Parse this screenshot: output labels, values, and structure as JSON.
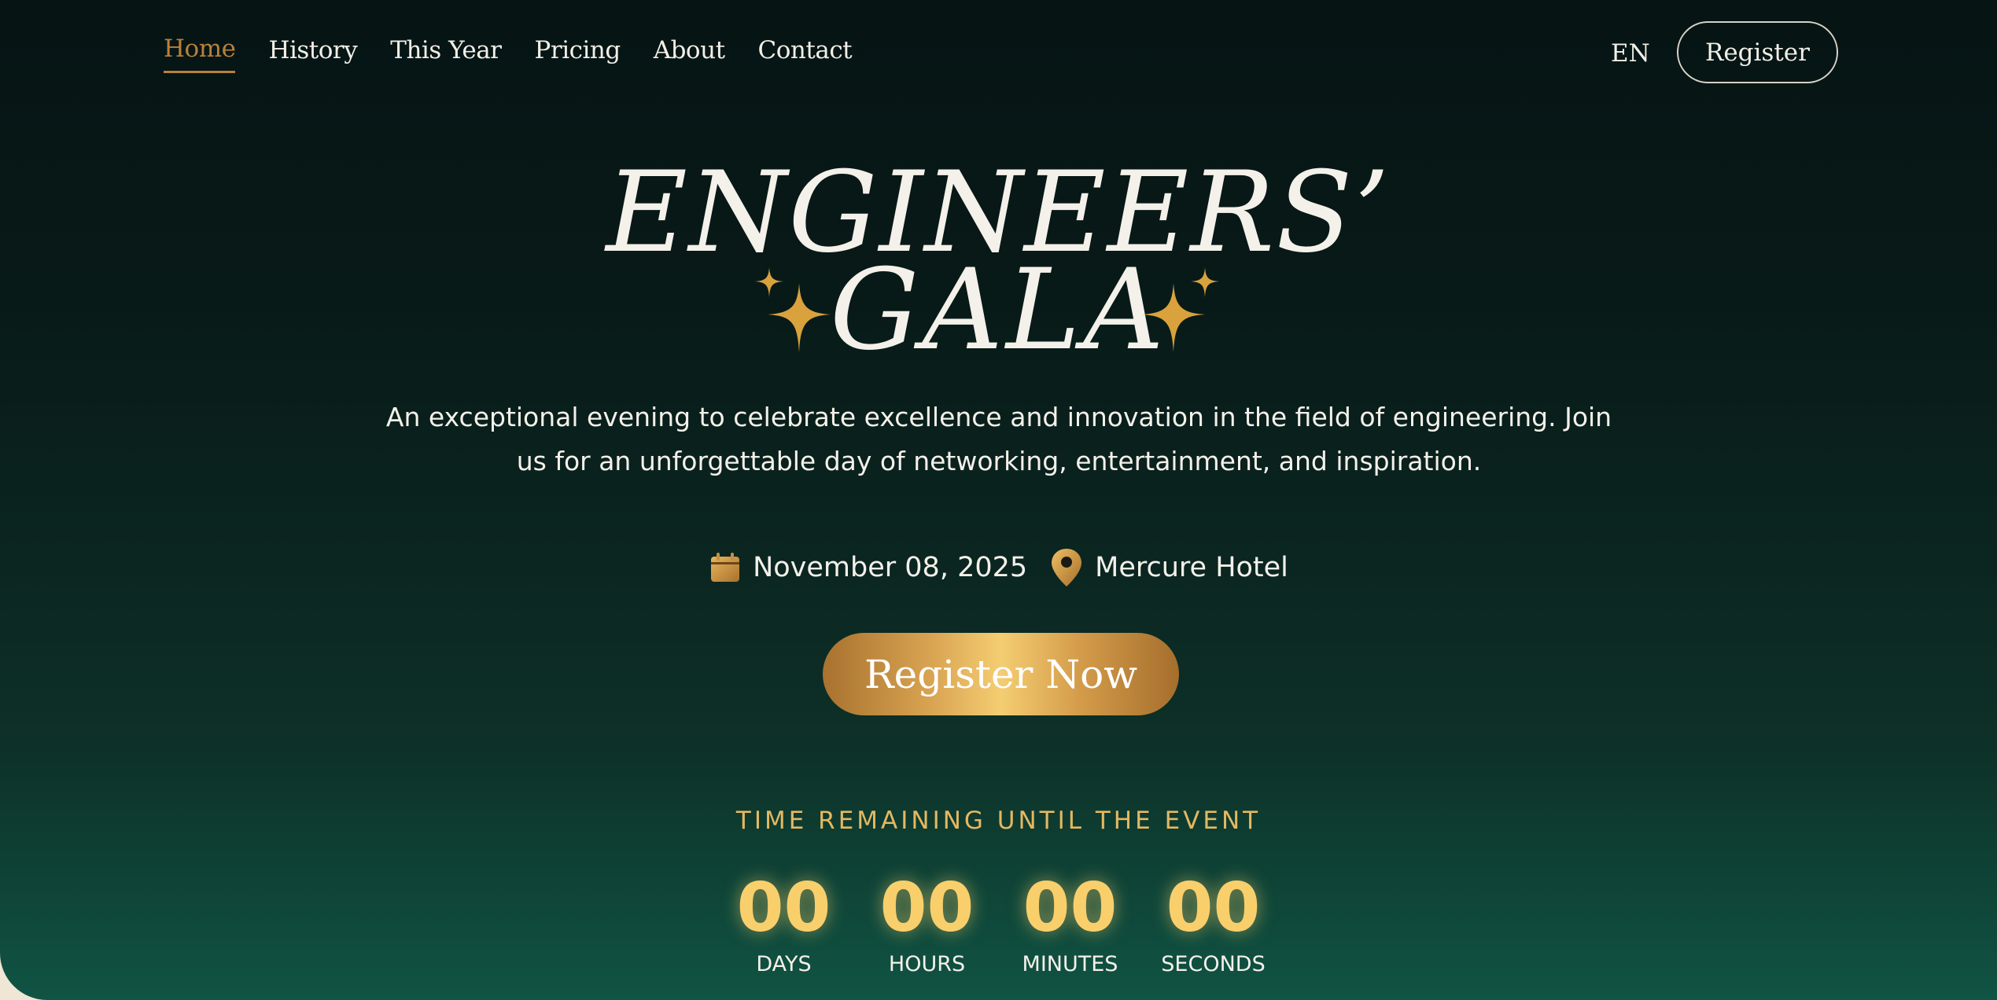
{
  "nav": {
    "items": [
      {
        "label": "Home",
        "active": true
      },
      {
        "label": "History"
      },
      {
        "label": "This Year"
      },
      {
        "label": "Pricing"
      },
      {
        "label": "About"
      },
      {
        "label": "Contact"
      }
    ],
    "language": "EN",
    "register_label": "Register"
  },
  "hero": {
    "title_line1": "ENGINEERS’",
    "title_line2": "GALA",
    "description": "An exceptional evening to celebrate excellence and innovation in the field of engineering. Join us for an unforgettable day of networking, entertainment, and inspiration.",
    "date": "November 08, 2025",
    "location": "Mercure Hotel",
    "cta_label": "Register Now",
    "date_icon": "calendar-icon",
    "location_icon": "map-pin-icon",
    "sparkle_icon": "sparkle-icon"
  },
  "countdown": {
    "heading": "TIME REMAINING UNTIL THE EVENT",
    "units": [
      {
        "value": "00",
        "label": "DAYS"
      },
      {
        "value": "00",
        "label": "HOURS"
      },
      {
        "value": "00",
        "label": "MINUTES"
      },
      {
        "value": "00",
        "label": "SECONDS"
      }
    ]
  },
  "colors": {
    "accent_gold": "#f9cf6c",
    "nav_active": "#b9803a",
    "background_dark": "#061414",
    "background_green": "#105444"
  }
}
